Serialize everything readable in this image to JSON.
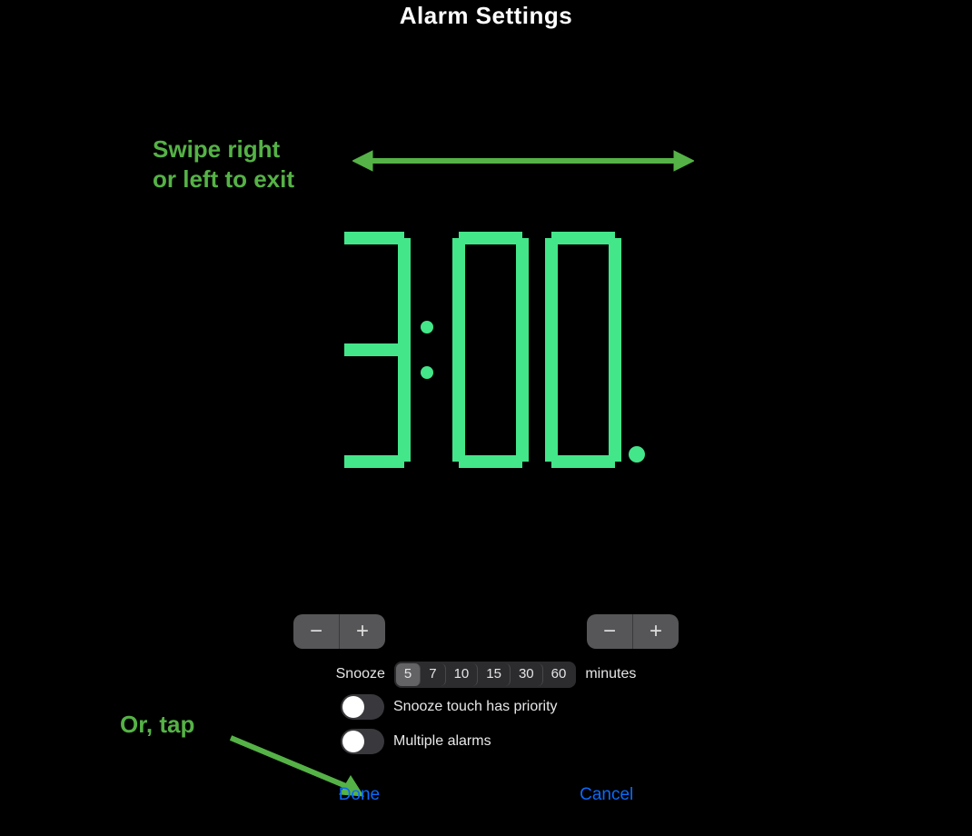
{
  "title": "Alarm Settings",
  "annotations": {
    "swipe": "Swipe right\nor left to exit",
    "or_tap": "Or, tap"
  },
  "clock": {
    "time": "3:00",
    "meridiem_indicator": "pm-dot",
    "color": "#43e689"
  },
  "snooze": {
    "label": "Snooze",
    "options": [
      5,
      7,
      10,
      15,
      30,
      60
    ],
    "selected": 5,
    "unit": "minutes"
  },
  "toggles": {
    "snooze_priority": {
      "label": "Snooze touch has priority",
      "on": false
    },
    "multiple_alarms": {
      "label": "Multiple alarms",
      "on": false
    }
  },
  "buttons": {
    "done": "Done",
    "cancel": "Cancel"
  },
  "steppers": {
    "minus": "−",
    "plus": "+"
  }
}
